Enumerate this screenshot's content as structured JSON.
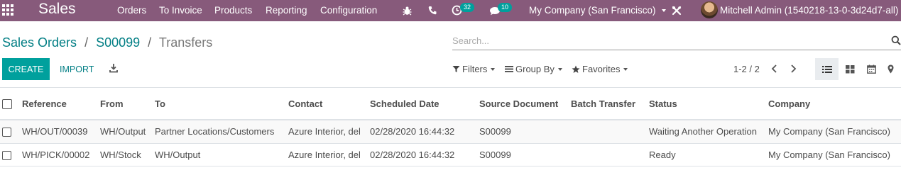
{
  "navbar": {
    "app_title": "Sales",
    "menu": [
      "Orders",
      "To Invoice",
      "Products",
      "Reporting",
      "Configuration"
    ],
    "activity_count": "32",
    "message_count": "10",
    "company": "My Company (San Francisco)",
    "user": "Mitchell Admin (1540218-13-0-3d24d7-all)"
  },
  "breadcrumb": {
    "first": "Sales Orders",
    "second": "S00099",
    "current": "Transfers",
    "sep": "/"
  },
  "search": {
    "placeholder": "Search..."
  },
  "actions": {
    "create": "CREATE",
    "import": "IMPORT"
  },
  "filters": {
    "filters": "Filters",
    "group_by": "Group By",
    "favorites": "Favorites"
  },
  "pager": {
    "value": "1-2 / 2"
  },
  "table": {
    "headers": [
      "Reference",
      "From",
      "To",
      "Contact",
      "Scheduled Date",
      "Source Document",
      "Batch Transfer",
      "Status",
      "Company"
    ],
    "rows": [
      [
        "WH/OUT/00039",
        "WH/Output",
        "Partner Locations/Customers",
        "Azure Interior, del",
        "02/28/2020 16:44:32",
        "S00099",
        "",
        "Waiting Another Operation",
        "My Company (San Francisco)"
      ],
      [
        "WH/PICK/00002",
        "WH/Stock",
        "WH/Output",
        "Azure Interior, del",
        "02/28/2020 16:44:32",
        "S00099",
        "",
        "Ready",
        "My Company (San Francisco)"
      ]
    ]
  },
  "colors": {
    "brand": "#875a7b",
    "accent": "#00a09d",
    "link": "#017e84"
  }
}
